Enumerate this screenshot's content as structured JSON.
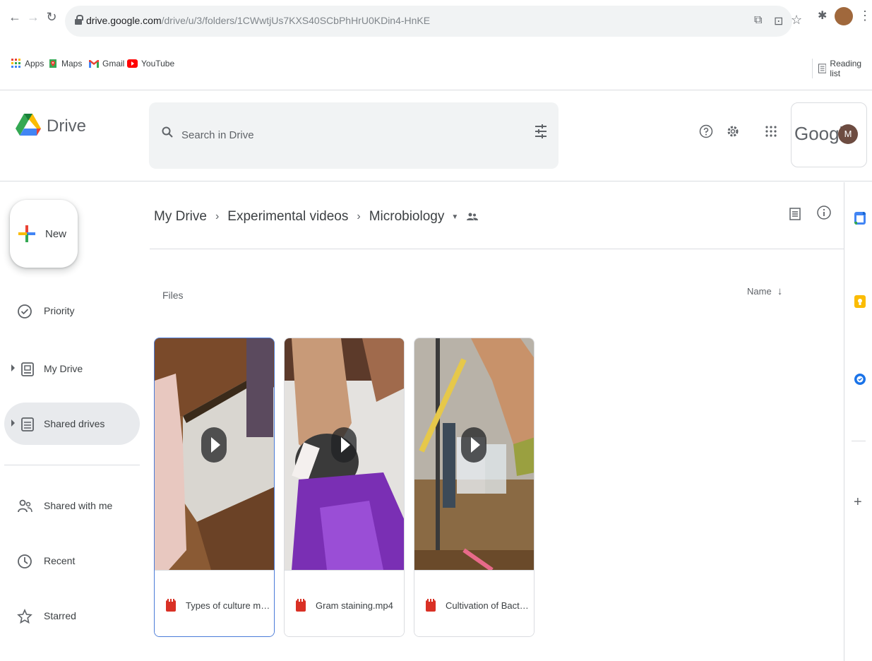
{
  "browser": {
    "url_host": "drive.google.com",
    "url_path": "/drive/u/3/folders/1CWwtjUs7KXS40SCbPhHrU0KDin4-HnKE",
    "bookmarks": [
      {
        "label": "Apps",
        "icon": "apps-grid-icon"
      },
      {
        "label": "Maps",
        "icon": "maps-icon"
      },
      {
        "label": "Gmail",
        "icon": "gmail-icon"
      },
      {
        "label": "YouTube",
        "icon": "youtube-icon"
      }
    ],
    "reading_list": "Reading list"
  },
  "header": {
    "product": "Drive",
    "search_placeholder": "Search in Drive",
    "google_label": "Google",
    "avatar_initial": "M"
  },
  "nav": {
    "new_label": "New",
    "items": [
      {
        "label": "Priority",
        "icon": "priority-check-icon"
      },
      {
        "label": "My Drive",
        "icon": "my-drive-icon"
      },
      {
        "label": "Shared drives",
        "icon": "shared-drives-icon"
      },
      {
        "label": "Shared with me",
        "icon": "shared-with-me-icon"
      },
      {
        "label": "Recent",
        "icon": "clock-icon"
      },
      {
        "label": "Starred",
        "icon": "star-icon"
      }
    ]
  },
  "main": {
    "breadcrumbs": [
      "My Drive",
      "Experimental videos",
      "Microbiology"
    ],
    "section_label": "Files",
    "sort_label": "Name",
    "files": [
      {
        "name": "Types of culture media..."
      },
      {
        "name": "Gram staining.mp4"
      },
      {
        "name": "Cultivation of Bacteria..."
      }
    ]
  },
  "colors": {
    "accent_blue": "#1a73e8",
    "selected_nav_bg": "#e8eaed",
    "video_red": "#d93025"
  }
}
